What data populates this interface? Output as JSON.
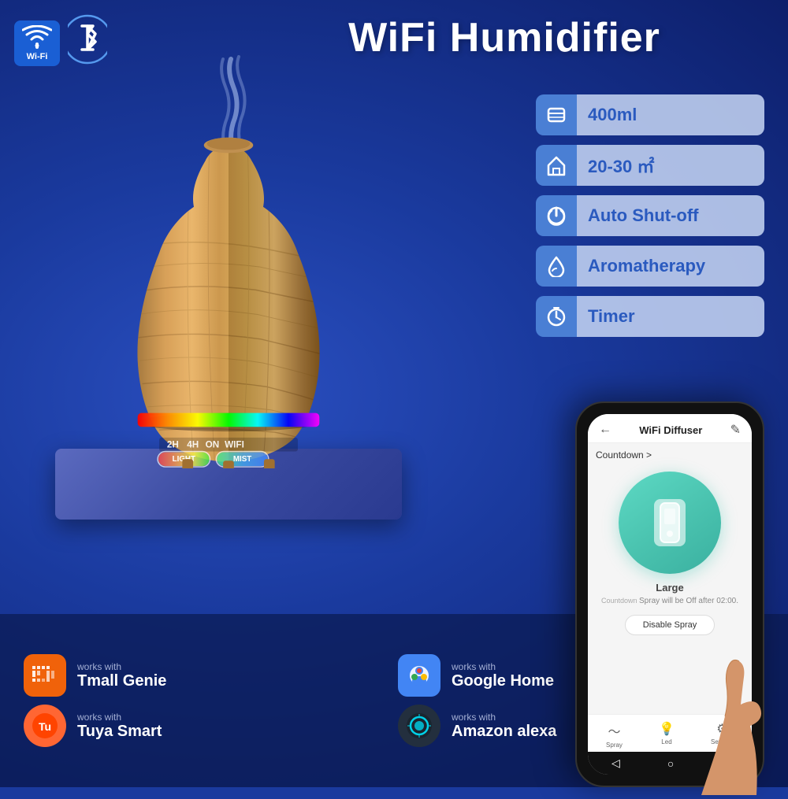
{
  "page": {
    "background_color": "#1a3a9e"
  },
  "header": {
    "title": "WiFi Humidifier",
    "wifi_label": "Wi-Fi"
  },
  "features": [
    {
      "id": "capacity",
      "icon": "≋",
      "label": "400ml",
      "icon_color": "#4a7fd4"
    },
    {
      "id": "coverage",
      "icon": "⌂",
      "label": "20-30 ㎡",
      "icon_color": "#4a7fd4"
    },
    {
      "id": "shutoff",
      "icon": "⏻",
      "label": "Auto Shut-off",
      "icon_color": "#4a7fd4"
    },
    {
      "id": "aromatherapy",
      "icon": "♦",
      "label": "Aromatherapy",
      "icon_color": "#4a7fd4"
    },
    {
      "id": "timer",
      "icon": "⏱",
      "label": "Timer",
      "icon_color": "#4a7fd4"
    }
  ],
  "vase_controls": {
    "labels": "2H  4H  ON  WIFI",
    "btn_light": "LIGHT",
    "btn_mist": "MIST"
  },
  "phone": {
    "title": "WiFi Diffuser",
    "back_icon": "←",
    "edit_icon": "✎",
    "countdown_label": "Countdown >",
    "size_label": "Large",
    "countdown_text": "Spray will be Off after 02:00.",
    "spray_btn": "Disable Spray",
    "footer_items": [
      {
        "icon": "〜",
        "label": "Spray"
      },
      {
        "icon": "💡",
        "label": "Led"
      },
      {
        "icon": "⚙",
        "label": "Settings"
      }
    ],
    "nav": [
      "◁",
      "○",
      "□"
    ]
  },
  "partners": [
    {
      "id": "tmall",
      "works_with": "works with",
      "name": "Tmall Genie",
      "icon": "T",
      "bg": "#f0620a"
    },
    {
      "id": "google",
      "works_with": "works with",
      "name": "Google Home",
      "icon": "G",
      "bg": "#4285F4"
    },
    {
      "id": "tuya",
      "works_with": "works with",
      "name": "Tuya Smart",
      "icon": "Tu",
      "bg": "#ff4500"
    },
    {
      "id": "alexa",
      "works_with": "works with",
      "name": "Amazon alexa",
      "icon": "A",
      "bg": "#232f3e"
    }
  ]
}
